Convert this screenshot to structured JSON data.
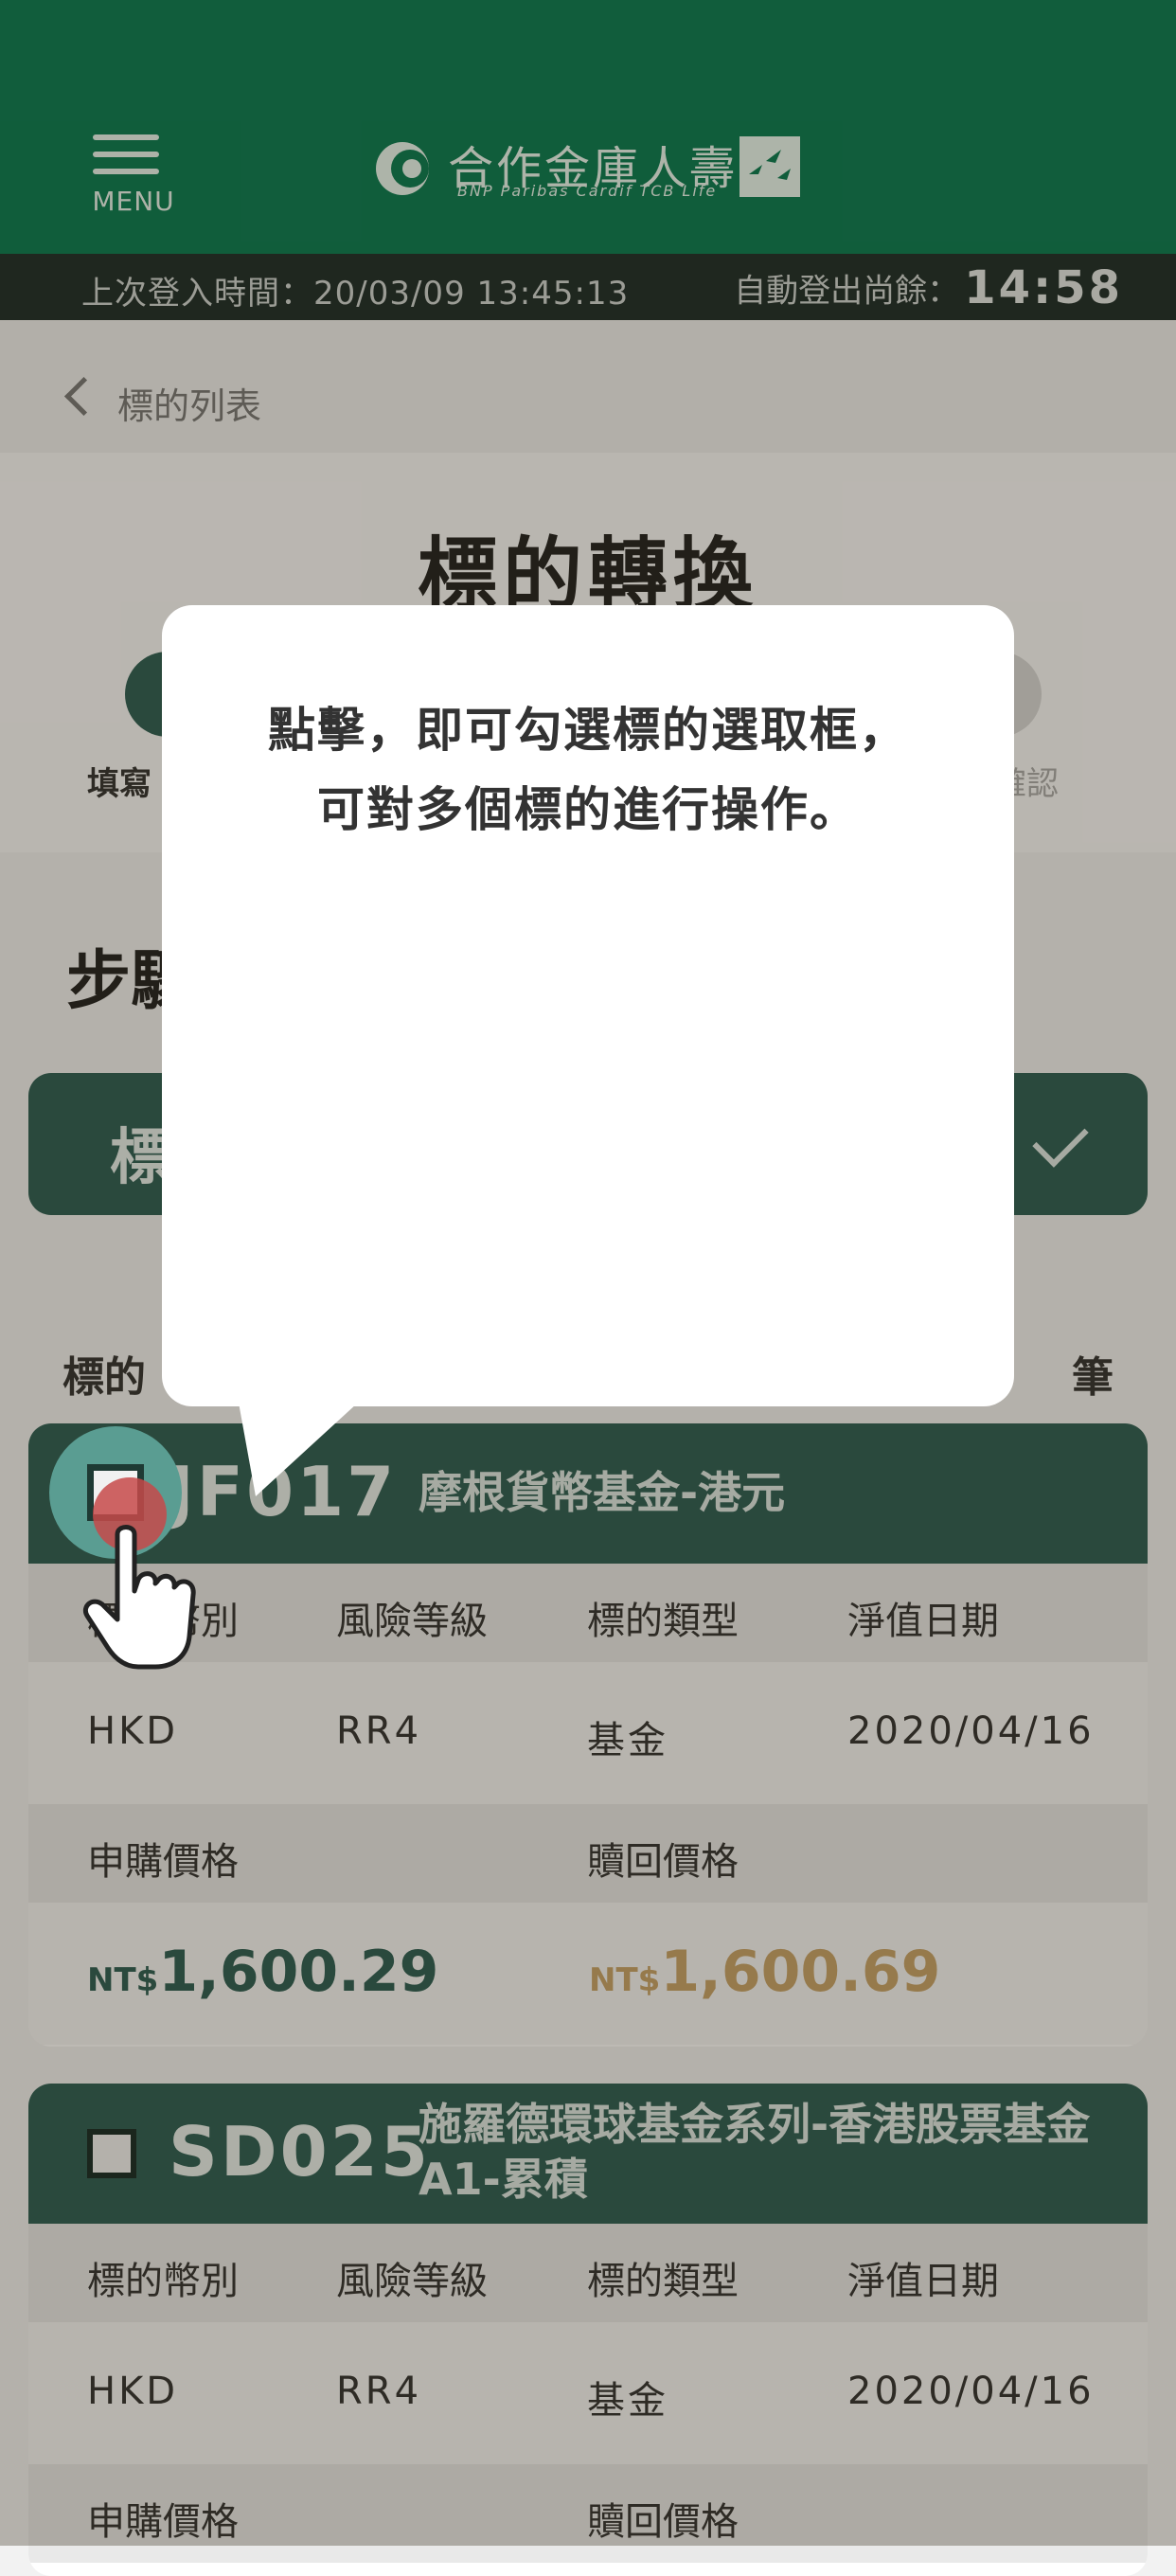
{
  "header": {
    "menu_label": "MENU",
    "logo_text": "合作金庫人壽",
    "logo_sub": "BNP Paribas Cardif TCB Life",
    "last_login": "上次登入時間：20/03/09 13:45:13",
    "auto_logout_label": "自動登出尚餘：",
    "auto_logout_time": "14:58"
  },
  "nav": {
    "back_label": "標的列表"
  },
  "page": {
    "title": "標的轉換",
    "step_left_label": "填寫",
    "step_right_label": "確認",
    "step_heading": "步驟",
    "select_text": "標",
    "list_label": "標的",
    "list_count": "筆"
  },
  "overlay": {
    "tooltip_line1": "點擊，即可勾選標的選取框，",
    "tooltip_line2": "可對多個標的進行操作。"
  },
  "table_headers": {
    "currency": "標的幣別",
    "risk": "風險等級",
    "type": "標的類型",
    "nav_date": "淨值日期",
    "buy_price": "申購價格",
    "redeem_price": "贖回價格"
  },
  "funds": [
    {
      "code": "JF017",
      "name": "摩根貨幣基金-港元",
      "currency": "HKD",
      "risk": "RR4",
      "type": "基金",
      "nav_date": "2020/04/16",
      "buy_currency": "NT$",
      "buy_price": "1,600.29",
      "redeem_currency": "NT$",
      "redeem_price": "1,600.69"
    },
    {
      "code": "SD025",
      "name_line1": "施羅德環球基金系列-香港股票基金",
      "name_line2": "A1-累積",
      "currency": "HKD",
      "risk": "RR4",
      "type": "基金",
      "nav_date": "2020/04/16"
    }
  ],
  "colors": {
    "brand_green": "#087a52",
    "card_header": "#2d5e55",
    "redeem_price": "#c8a46a",
    "buy_price": "#2d5e55"
  }
}
